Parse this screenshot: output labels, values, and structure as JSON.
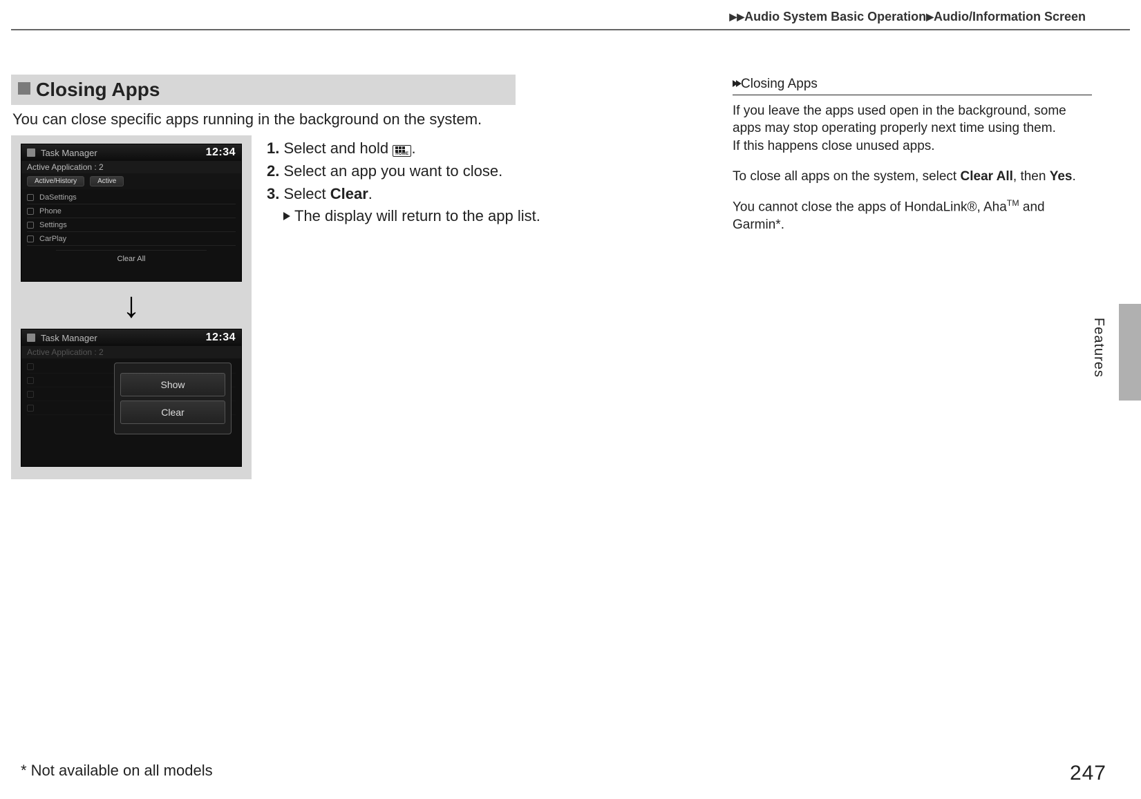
{
  "header": {
    "crumb1": "Audio System Basic Operation",
    "crumb2": "Audio/Information Screen"
  },
  "main": {
    "section_title": "Closing Apps",
    "intro": "You can close specific apps running in the background on the system.",
    "steps": {
      "s1_prefix": "1.",
      "s1_text": " Select and hold ",
      "s1_suffix": ".",
      "home_label": "HOME",
      "s2_prefix": "2.",
      "s2_text": " Select an app you want to close.",
      "s3_prefix": "3.",
      "s3_text_a": " Select ",
      "s3_bold": "Clear",
      "s3_text_b": ".",
      "s3_result": "The display will return to the app list."
    },
    "screenshot1": {
      "title": "Task Manager",
      "clock": "12:34",
      "subtitle": "Active Application : 2",
      "tab1": "Active/History",
      "tab2": "Active",
      "rows": [
        "DaSettings",
        "Phone",
        "Settings",
        "CarPlay"
      ],
      "clear_all": "Clear All"
    },
    "screenshot2": {
      "title": "Task Manager",
      "clock": "12:34",
      "subtitle": "Active Application : 2",
      "popup": {
        "show": "Show",
        "clear": "Clear"
      }
    }
  },
  "side": {
    "title": "Closing Apps",
    "p1a": "If you leave the apps used open in the background, some apps may stop operating properly next time using them.",
    "p1b": "If this happens close unused apps.",
    "p2_a": "To close all apps on the system, select ",
    "p2_bold1": "Clear All",
    "p2_b": ", then ",
    "p2_bold2": "Yes",
    "p2_c": ".",
    "p3_a": "You cannot close the apps of HondaLink",
    "p3_reg": "®",
    "p3_b": ", Aha",
    "p3_tm": "TM",
    "p3_c": " and Garmin",
    "p3_star": "*",
    "p3_d": "."
  },
  "tab": {
    "label": "Features"
  },
  "footer": {
    "note": "* Not available on all models",
    "page": "247"
  }
}
